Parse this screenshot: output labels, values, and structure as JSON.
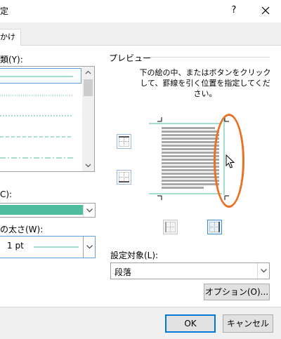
{
  "window": {
    "title": "定",
    "help_glyph": "?",
    "close_icon": "close-icon"
  },
  "tabs": [
    {
      "label": "かけ"
    }
  ],
  "left": {
    "style_label": "類(Y):",
    "style_options": [
      "solid",
      "dotted",
      "dotted",
      "dashed",
      "dash-dot"
    ],
    "selected_index": 0,
    "color_label": "C):",
    "color_value": "#4dbd9e",
    "width_label": "の太さ(W):",
    "width_value": "1 pt"
  },
  "preview": {
    "group_title": "プレビュー",
    "instructions": "下の絵の中、またはボタンをクリックして、罫線を引く位置を指定してください。"
  },
  "apply_to": {
    "label": "設定対象(L):",
    "value": "段落"
  },
  "buttons": {
    "options": "オプション(O)...",
    "ok": "OK",
    "cancel": "キャンセル"
  },
  "colors": {
    "accent": "#4dbd9e",
    "annotation": "#eb7022",
    "focus": "#0078d7"
  }
}
